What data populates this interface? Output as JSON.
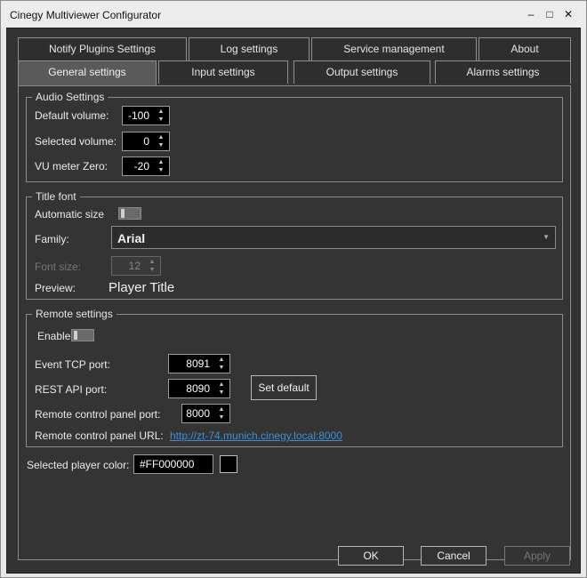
{
  "window": {
    "title": "Cinegy Multiviewer Configurator",
    "controls": {
      "minimize": "–",
      "maximize": "□",
      "close": "✕"
    }
  },
  "tabs": {
    "row1": [
      "Notify Plugins Settings",
      "Log settings",
      "Service management",
      "About"
    ],
    "row2": [
      "General settings",
      "Input settings",
      "Output settings",
      "Alarms settings"
    ],
    "active": "General settings"
  },
  "audio": {
    "title": "Audio Settings",
    "default_volume_label": "Default volume:",
    "default_volume": "-100",
    "selected_volume_label": "Selected volume:",
    "selected_volume": "0",
    "vu_zero_label": "VU meter Zero:",
    "vu_zero": "-20"
  },
  "title_font": {
    "title": "Title font",
    "auto_size_label": "Automatic size",
    "family_label": "Family:",
    "family": "Arial",
    "font_size_label": "Font size:",
    "font_size": "12",
    "preview_label": "Preview:",
    "preview_text": "Player Title"
  },
  "remote": {
    "title": "Remote settings",
    "enable_label": "Enable",
    "event_tcp_label": "Event TCP port:",
    "event_tcp": "8091",
    "rest_api_label": "REST API port:",
    "rest_api": "8090",
    "set_default": "Set default",
    "rcp_port_label": "Remote control panel port:",
    "rcp_port": "8000",
    "rcp_url_label": "Remote control panel URL:",
    "rcp_url": "http://zt-74.munich.cinegy.local:8000"
  },
  "player_color": {
    "label": "Selected player color:",
    "value": "#FF000000",
    "swatch_color": "#000000"
  },
  "footer": {
    "ok": "OK",
    "cancel": "Cancel",
    "apply": "Apply"
  },
  "colors": {
    "background": "#333333",
    "link": "#3d8fd8",
    "active_tab": "#5a5a5a"
  }
}
